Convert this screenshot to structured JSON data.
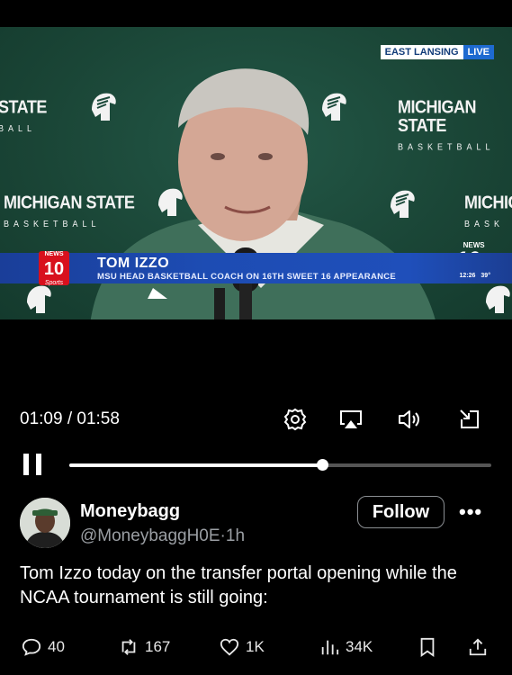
{
  "video": {
    "live_location": "EAST LANSING",
    "live_tag": "LIVE",
    "backdrop_logo_main": "MICHIGAN STATE",
    "backdrop_logo_sub": "BASKETBALL",
    "backdrop_logo_left_main": "STATE",
    "backdrop_logo_left_sub": "BALL",
    "backdrop_logo_right_main": "MICHIG",
    "backdrop_logo_right_sub": "BASK",
    "lower_third_name": "TOM IZZO",
    "lower_third_title": "MSU HEAD BASKETBALL COACH ON 16TH SWEET 16 APPEARANCE",
    "station_left_num": "10",
    "station_left_top": "NEWS",
    "station_left_bottom": "Sports",
    "station_right_num": "10+",
    "station_right_top": "NEWS",
    "clock_time": "12:26",
    "clock_temp": "39°"
  },
  "player": {
    "time": "01:09 / 01:58",
    "progress": 0.6
  },
  "tweet": {
    "display_name": "Moneybagg",
    "handle": "@MoneybaggH0E",
    "separator": "·",
    "age": "1h",
    "follow_label": "Follow",
    "more_label": "•••",
    "text": "Tom Izzo today on the transfer portal opening while the NCAA tournament is still going:",
    "replies": "40",
    "reposts": "167",
    "likes": "1K",
    "views": "34K"
  },
  "icons": [
    "settings-icon",
    "airplay-icon",
    "volume-icon",
    "exit-fullscreen-icon",
    "pause-icon",
    "reply-icon",
    "repost-icon",
    "like-icon",
    "views-icon",
    "bookmark-icon",
    "share-icon"
  ]
}
